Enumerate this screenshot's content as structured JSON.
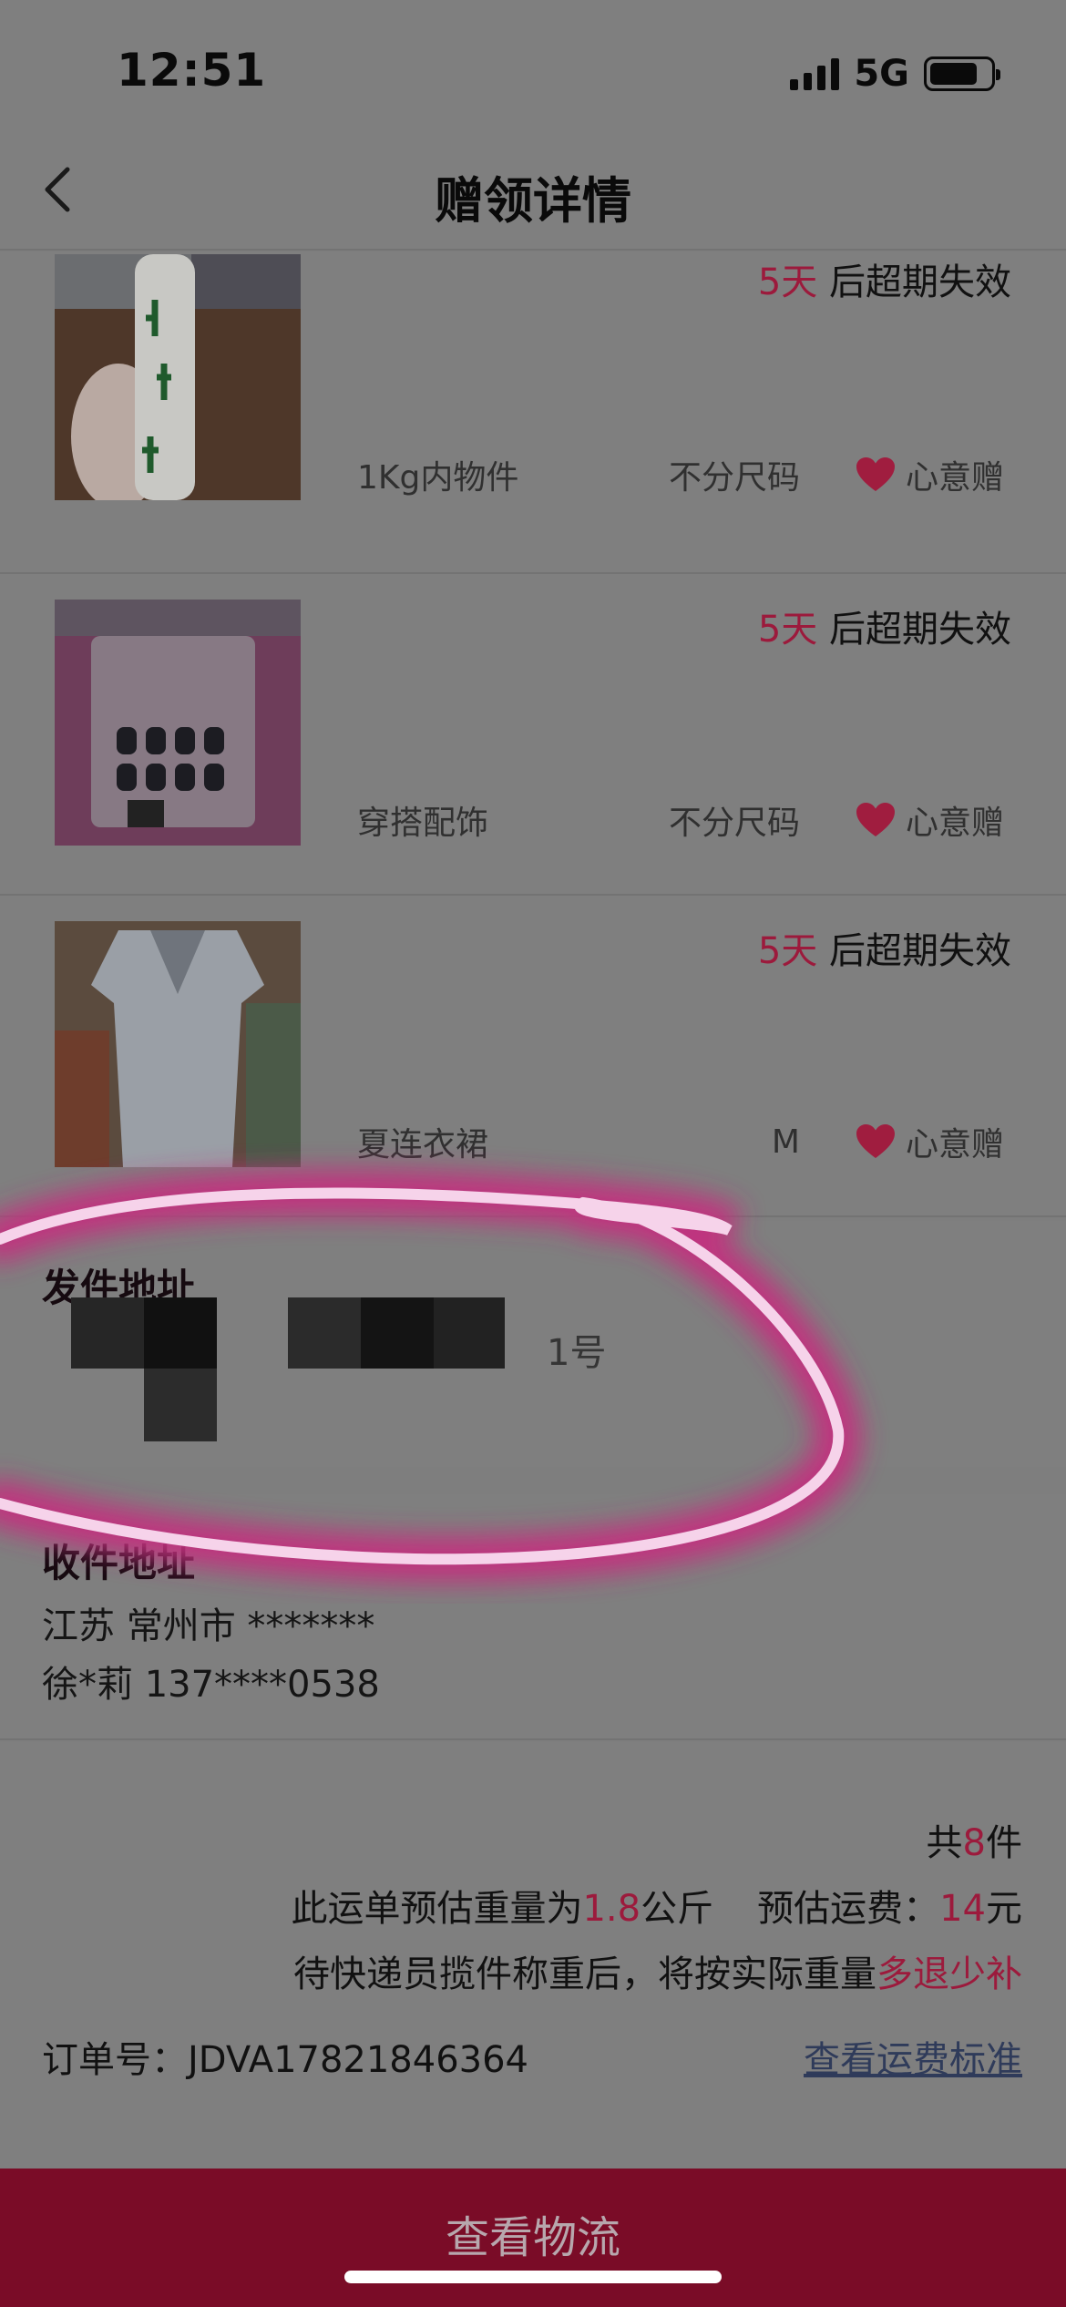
{
  "status_bar": {
    "time": "12:51",
    "network": "5G",
    "battery_level": 0.8
  },
  "nav": {
    "title": "赠领详情"
  },
  "items": [
    {
      "days": "5天",
      "expire_suffix": " 后超期失效",
      "category": "1Kg内物件",
      "size": "不分尺码",
      "gift_label": "心意赠"
    },
    {
      "days": "5天",
      "expire_suffix": " 后超期失效",
      "category": "穿搭配饰",
      "size": "不分尺码",
      "gift_label": "心意赠"
    },
    {
      "days": "5天",
      "expire_suffix": " 后超期失效",
      "category": "夏连衣裙",
      "size": "M",
      "gift_label": "心意赠"
    }
  ],
  "send_address": {
    "heading": "发件地址",
    "visible_tail": "1号"
  },
  "receive_address": {
    "heading": "收件地址",
    "region": "江苏 常州市 *******",
    "contact": "徐*莉 137****0538"
  },
  "summary": {
    "count_prefix": "共",
    "count": "8",
    "count_suffix": "件",
    "weight_prefix": "此运单预估重量为",
    "weight": "1.8",
    "weight_unit": "公斤",
    "fee_prefix": "预估运费：",
    "fee": "14",
    "fee_unit": "元",
    "note_prefix": "待快递员揽件称重后，将按实际重量",
    "note_emph": "多退少补",
    "order_label": "订单号：",
    "order_no": "JDVA17821846364",
    "fee_link": "查看运费标准"
  },
  "bottom": {
    "button_label": "查看物流"
  },
  "colors": {
    "accent": "#9c1a3c",
    "bottom_bar": "#7a0c27",
    "overlay_bg": "#7f7f7f",
    "highlight": "#c2307f"
  }
}
